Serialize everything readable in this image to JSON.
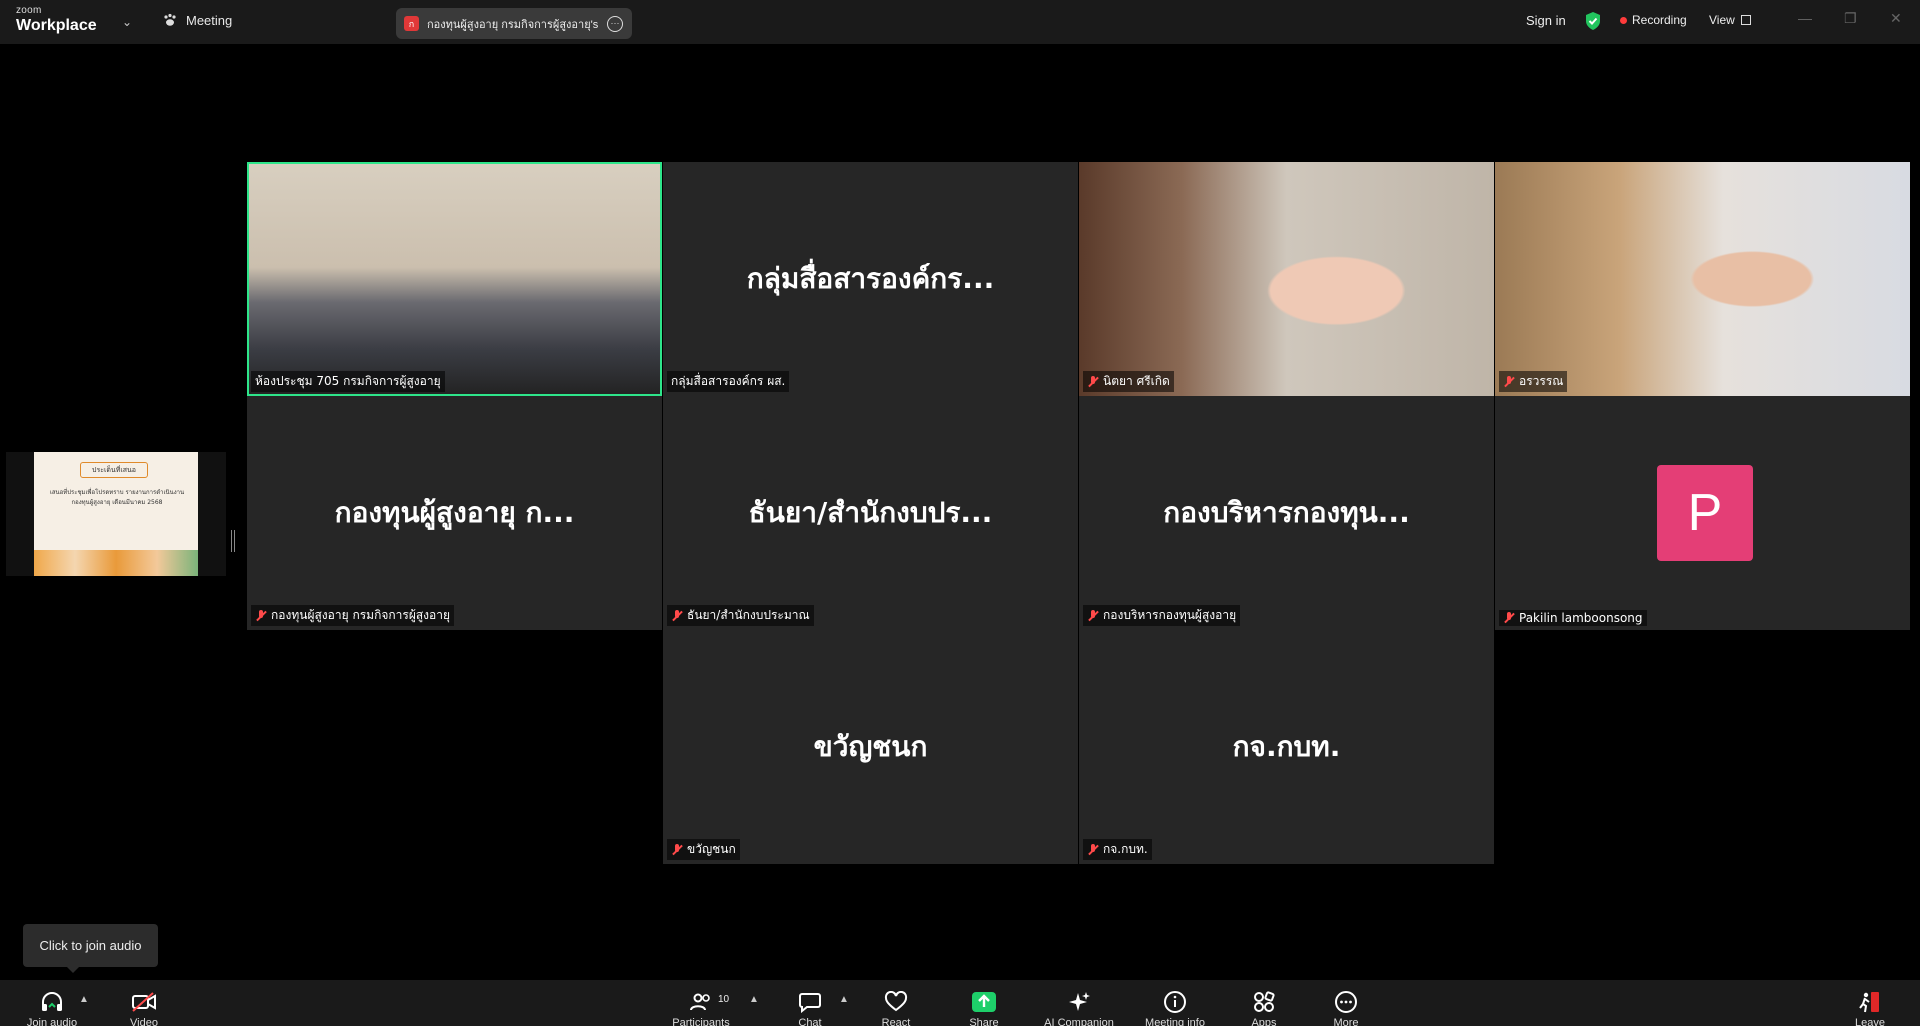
{
  "app": {
    "brand_small": "zoom",
    "brand_name": "Workplace",
    "meeting_label": "Meeting"
  },
  "share_chip": {
    "avatar": "ก",
    "text": "กองทุนผู้สูงอายุ กรมกิจการผู้สูงอายุ's sc"
  },
  "header": {
    "signin": "Sign in",
    "recording": "Recording",
    "view": "View"
  },
  "colors": {
    "active_border": "#2ee58a",
    "recording_dot": "#ff3b3b",
    "avatar_p": "#e43e76",
    "share_green": "#1ecf6a"
  },
  "tiles": [
    {
      "type": "video",
      "name": "ห้องประชุม 705 กรมกิจการผู้สูงอายุ",
      "active": true,
      "muted": false
    },
    {
      "type": "name",
      "big": "กลุ่มสื่อสารองค์กร...",
      "name": "กลุ่มสื่อสารองค์กร ผส.",
      "muted": false
    },
    {
      "type": "video",
      "name": "นิตยา ศรีเกิด",
      "muted": true
    },
    {
      "type": "video",
      "name": "อรวรรณ",
      "muted": true
    },
    {
      "type": "name",
      "big": "กองทุนผู้สูงอายุ ก...",
      "name": "กองทุนผู้สูงอายุ กรมกิจการผู้สูงอายุ",
      "muted": true
    },
    {
      "type": "name",
      "big": "ธันยา/สำนักงบปร...",
      "name": "ธันยา/สำนักงบประมาณ",
      "muted": true
    },
    {
      "type": "name",
      "big": "กองบริหารกองทุน...",
      "name": "กองบริหารกองทุนผู้สูงอายุ",
      "muted": true
    },
    {
      "type": "avatar",
      "initial": "P",
      "name": "Pakilin lamboonsong",
      "muted": true
    },
    {
      "type": "name",
      "big": "ขวัญชนก",
      "name": "ขวัญชนก",
      "muted": true
    },
    {
      "type": "name",
      "big": "กจ.กบท.",
      "name": "กจ.กบท.",
      "muted": true
    }
  ],
  "thumbnail": {
    "slide_title": "ประเด็นที่เสนอ",
    "slide_body": "เสนอที่ประชุมเพื่อโปรดทราบ รายงานการดำเนินงานกองทุนผู้สูงอายุ เดือนมีนาคม 2568"
  },
  "tooltip": "Click to join audio",
  "toolbar": {
    "join_audio": "Join audio",
    "video": "Video",
    "participants": "Participants",
    "participants_count": "10",
    "chat": "Chat",
    "react": "React",
    "share": "Share",
    "ai_companion": "AI Companion",
    "meeting_info": "Meeting info",
    "apps": "Apps",
    "more": "More",
    "leave": "Leave"
  }
}
